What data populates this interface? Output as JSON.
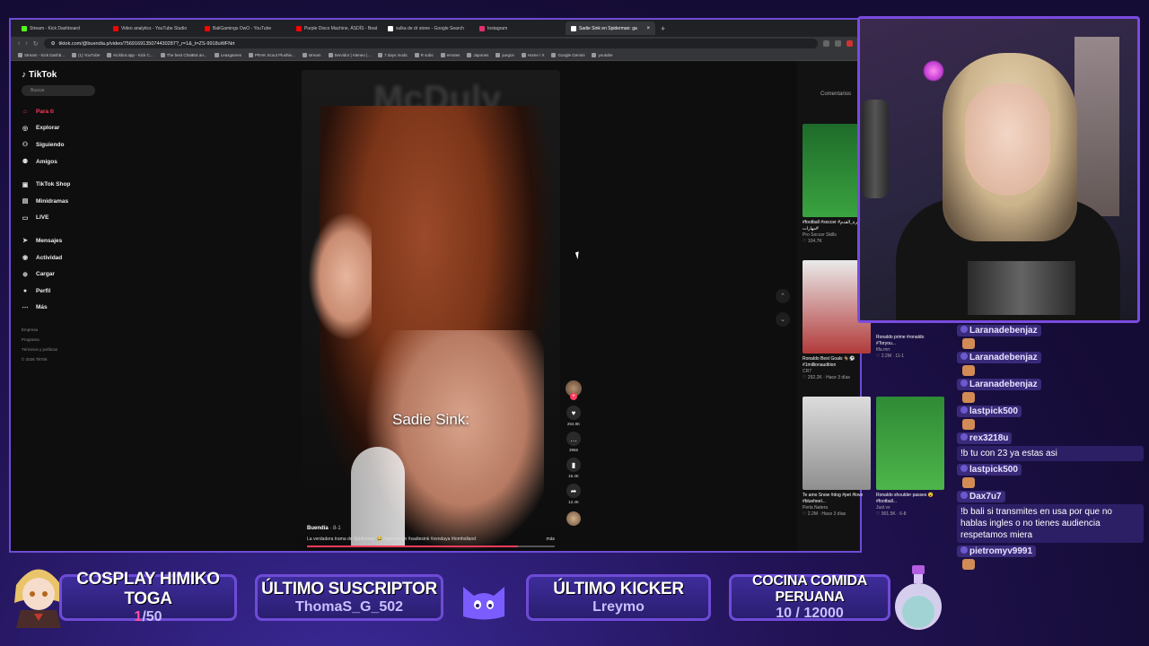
{
  "browser": {
    "tabs": [
      {
        "label": "Stream - Kick Dashboard",
        "color": "#53fc18"
      },
      {
        "label": "Video analytics - YouTube Studio",
        "color": "#ff0000"
      },
      {
        "label": "BaliGamings OwO - YouTube",
        "color": "#ff0000"
      },
      {
        "label": "Purple Disco Machine, ÁSDÍS - Beat",
        "color": "#ff0000"
      },
      {
        "label": "sulka de dr stone - Google Search",
        "color": "#ffffff"
      },
      {
        "label": "Instagram",
        "color": "#e1306c"
      },
      {
        "label": "Sadie Sink en Spiderman: ga",
        "color": "#ffffff"
      }
    ],
    "url": "tiktok.com/@buendia.p/video/7569169135074430287?_r=1&_t=ZS-9918uWFNrt",
    "bookmarks": [
      "Stream - Kick Dashb...",
      "(1) YouTube",
      "Kickbot.app - Kick C...",
      "The best ChatBot an...",
      "Leaxgames",
      "PRAK Scout Plushie...",
      "stream",
      "Servidor | Ateneo |...",
      "7 days mods",
      "R subs",
      "emotes",
      "Japones",
      "juegos",
      "Home / X",
      "Google Gemini",
      "youtube"
    ]
  },
  "tiktok": {
    "logo": "TikTok",
    "search_placeholder": "Buscar",
    "menu": [
      {
        "label": "Para ti",
        "icon": "home-icon",
        "glyph": "⌂",
        "active": true
      },
      {
        "label": "Explorar",
        "icon": "compass-icon",
        "glyph": "◎"
      },
      {
        "label": "Siguiendo",
        "icon": "following-icon",
        "glyph": "⚇"
      },
      {
        "label": "Amigos",
        "icon": "friends-icon",
        "glyph": "⚉"
      },
      {
        "label": "TikTok Shop",
        "icon": "shop-icon",
        "glyph": "▣",
        "gap": true
      },
      {
        "label": "Minidramas",
        "icon": "minidrama-icon",
        "glyph": "▤"
      },
      {
        "label": "LIVE",
        "icon": "live-icon",
        "glyph": "▭"
      },
      {
        "label": "Mensajes",
        "icon": "message-icon",
        "glyph": "➤",
        "gap": true
      },
      {
        "label": "Actividad",
        "icon": "activity-icon",
        "glyph": "◉"
      },
      {
        "label": "Cargar",
        "icon": "upload-icon",
        "glyph": "⊕"
      },
      {
        "label": "Perfil",
        "icon": "profile-icon",
        "glyph": "●"
      },
      {
        "label": "Más",
        "icon": "more-icon",
        "glyph": "⋯"
      }
    ],
    "footer": [
      "Empresa",
      "Programa",
      "Términos y políticas",
      "© 2026 TikTok"
    ],
    "video": {
      "overlay_text": "Sadie Sink:",
      "author": "Buendía",
      "date": "· 8-1",
      "description": "La verdadera trama de Spiderman 😂 #spiderman #sadiesink #zendaya #tomholland",
      "more_label": "más",
      "progress": 0.85
    },
    "actions": [
      {
        "name": "like",
        "glyph": "♥",
        "count": "284.9K"
      },
      {
        "name": "comment",
        "glyph": "…",
        "count": "3956"
      },
      {
        "name": "save",
        "glyph": "▮",
        "count": "16.4K"
      },
      {
        "name": "share",
        "glyph": "➦",
        "count": "12.4K"
      }
    ],
    "right_panel_title": "Comentarios",
    "related": [
      {
        "caption": "#football #soccer #كرة_القدم #مهارات",
        "author": "Pro Soccer Skills",
        "stats": "♡ 104.7K"
      },
      {
        "caption": "Ronaldo Best Goals 🐐⚽ #1millionaudition",
        "author": "CR7",
        "stats": "♡ 292.2K · Hace 3 días"
      },
      {
        "caption": "Ronaldo prime #ronaldo #Toryou...",
        "author": "fifa.mrr",
        "stats": "♡ 2.2M · 11-1"
      },
      {
        "caption": "Te amo Snow #dog #pet #love #blueheel...",
        "author": "Perla Natera",
        "stats": "♡ 2.2M · Hace 3 días"
      },
      {
        "caption": "Ronaldo shoulder passes 😮 #football...",
        "author": "Just vx",
        "stats": "♡ 901.5K · 6-8"
      }
    ]
  },
  "chat": [
    {
      "user": "Laranadebenjaz",
      "text": "",
      "emote": true
    },
    {
      "user": "Laranadebenjaz",
      "text": "",
      "emote": true
    },
    {
      "user": "Laranadebenjaz",
      "text": "",
      "emote": true
    },
    {
      "user": "lastpick500",
      "text": "",
      "emote": true
    },
    {
      "user": "rex3218u",
      "text": "!b tu con 23 ya estas asi",
      "emote": false
    },
    {
      "user": "lastpick500",
      "text": "",
      "emote": true
    },
    {
      "user": "Dax7u7",
      "text": "!b bali si transmites en usa por que no hablas ingles o no tienes audiencia respetamos miera",
      "emote": false
    },
    {
      "user": "pietromyv9991",
      "text": "",
      "emote": true
    }
  ],
  "bottom": {
    "goal1": {
      "title": "COSPLAY HIMIKO TOGA",
      "current": "1",
      "total": "/50"
    },
    "subscriber": {
      "title": "ÚLTIMO SUSCRIPTOR",
      "value": "ThomaS_G_502"
    },
    "kicker": {
      "title": "ÚLTIMO KICKER",
      "value": "Lreymo"
    },
    "goal2": {
      "title": "COCINA COMIDA PERUANA",
      "value": "10 / 12000"
    }
  },
  "colors": {
    "accent": "#6e4bd6",
    "tiktok_red": "#ff3b5c",
    "kick_green": "#53fc18"
  }
}
